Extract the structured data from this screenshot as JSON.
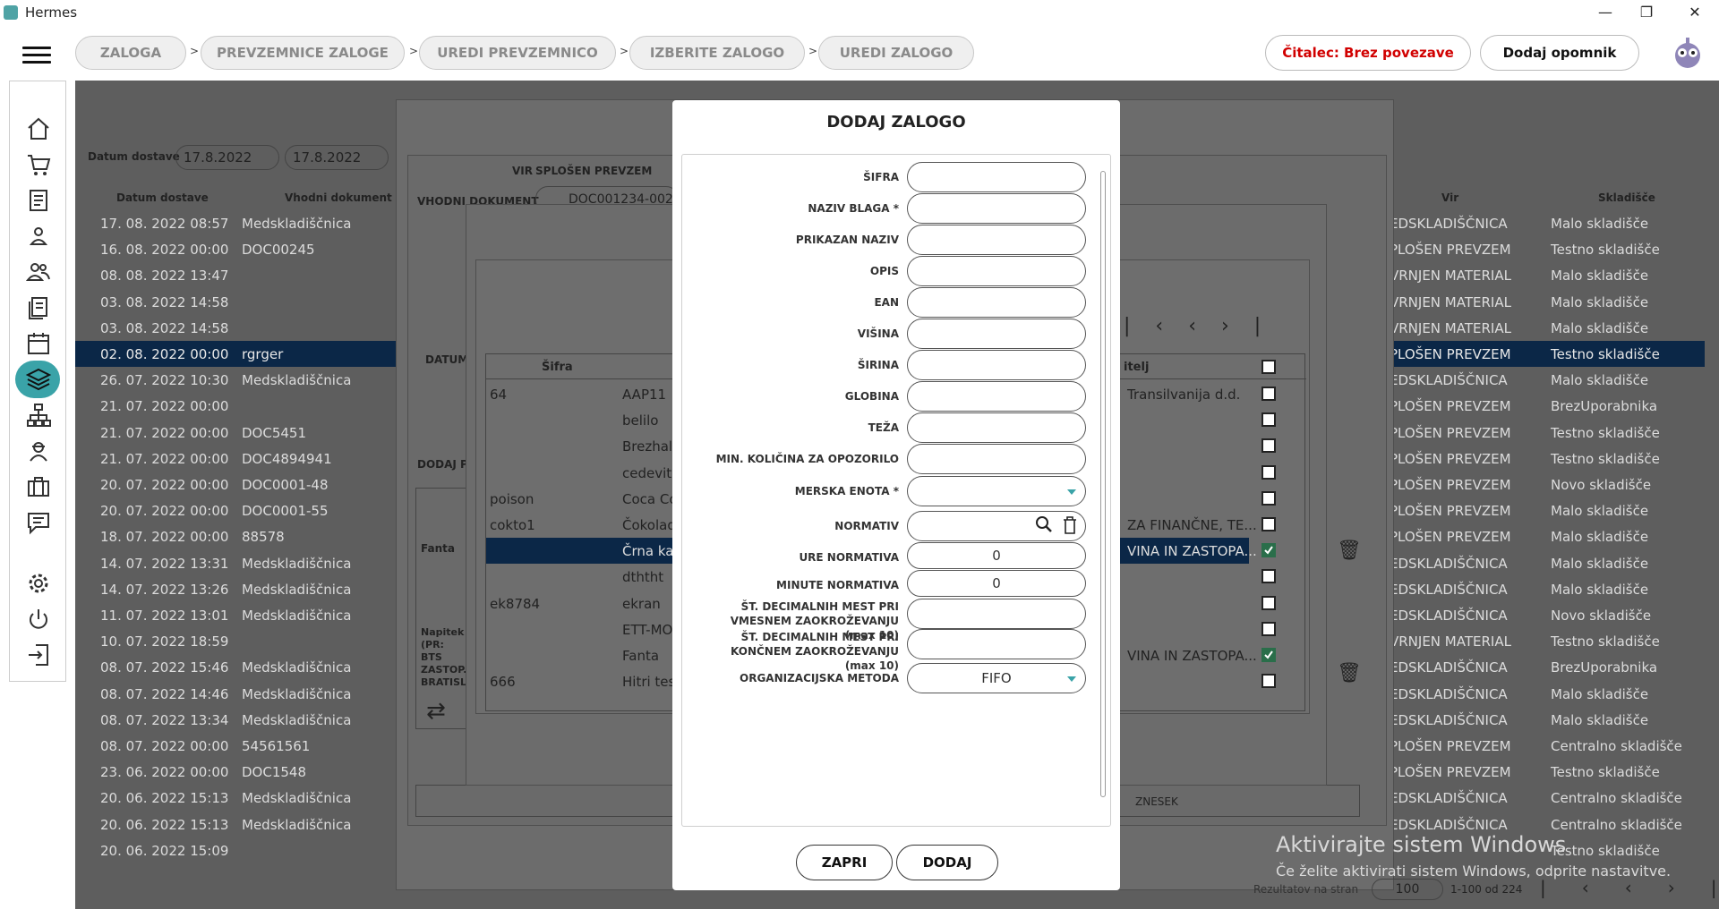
{
  "app": {
    "title": "Hermes",
    "win": {
      "min": "—",
      "max": "❐",
      "close": "✕"
    }
  },
  "breadcrumb": [
    "ZALOGA",
    "PREVZEMNICE ZALOGE",
    "UREDI PREVZEMNICO",
    "IZBERITE ZALOGO",
    "UREDI ZALOGO"
  ],
  "breadcrumb_sep": ">",
  "header": {
    "reader": "Čitalec: Brez povezave",
    "reminder": "Dodaj opomnik"
  },
  "filter": {
    "label": "Datum dostave",
    "from": "17.8.2022",
    "to": "17.8.2022"
  },
  "table": {
    "headers": {
      "date": "Datum dostave",
      "doc": "Vhodni dokument",
      "vir": "Vir",
      "sklad": "Skladišče"
    },
    "rows": [
      [
        "17. 08. 2022 08:57",
        "Medskladiščnica",
        "EDSKLADIŠČNICA",
        "Malo skladišče"
      ],
      [
        "16. 08. 2022 00:00",
        "DOC00245",
        "PLOŠEN PREVZEM",
        "Testno skladišče"
      ],
      [
        "08. 08. 2022 13:47",
        "",
        "VRNJEN MATERIAL",
        "Malo skladišče"
      ],
      [
        "03. 08. 2022 14:58",
        "",
        "VRNJEN MATERIAL",
        "Malo skladišče"
      ],
      [
        "03. 08. 2022 14:58",
        "",
        "VRNJEN MATERIAL",
        "Malo skladišče"
      ],
      [
        "02. 08. 2022 00:00",
        "rgrger",
        "PLOŠEN PREVZEM",
        "Testno skladišče"
      ],
      [
        "26. 07. 2022 10:30",
        "Medskladiščnica",
        "EDSKLADIŠČNICA",
        "Malo skladišče"
      ],
      [
        "21. 07. 2022 00:00",
        "",
        "PLOŠEN PREVZEM",
        "BrezUporabnika"
      ],
      [
        "21. 07. 2022 00:00",
        "DOC5451",
        "PLOŠEN PREVZEM",
        "Testno skladišče"
      ],
      [
        "21. 07. 2022 00:00",
        "DOC4894941",
        "PLOŠEN PREVZEM",
        "Testno skladišče"
      ],
      [
        "20. 07. 2022 00:00",
        "DOC0001-48",
        "PLOŠEN PREVZEM",
        "Novo skladišče"
      ],
      [
        "20. 07. 2022 00:00",
        "DOC0001-55",
        "PLOŠEN PREVZEM",
        "Malo skladišče"
      ],
      [
        "18. 07. 2022 00:00",
        "88578",
        "PLOŠEN PREVZEM",
        "Malo skladišče"
      ],
      [
        "14. 07. 2022 13:31",
        "Medskladiščnica",
        "EDSKLADIŠČNICA",
        "Malo skladišče"
      ],
      [
        "14. 07. 2022 13:26",
        "Medskladiščnica",
        "EDSKLADIŠČNICA",
        "Malo skladišče"
      ],
      [
        "11. 07. 2022 13:01",
        "Medskladiščnica",
        "EDSKLADIŠČNICA",
        "Novo skladišče"
      ],
      [
        "10. 07. 2022 18:59",
        "",
        "VRNJEN MATERIAL",
        "Testno skladišče"
      ],
      [
        "08. 07. 2022 15:46",
        "Medskladiščnica",
        "EDSKLADIŠČNICA",
        "BrezUporabnika"
      ],
      [
        "08. 07. 2022 14:46",
        "Medskladiščnica",
        "EDSKLADIŠČNICA",
        "Malo skladišče"
      ],
      [
        "08. 07. 2022 13:34",
        "Medskladiščnica",
        "EDSKLADIŠČNICA",
        "Malo skladišče"
      ],
      [
        "08. 07. 2022 00:00",
        "54561561",
        "PLOŠEN PREVZEM",
        "Centralno skladišče"
      ],
      [
        "23. 06. 2022 00:00",
        "DOC1548",
        "PLOŠEN PREVZEM",
        "Testno skladišče"
      ],
      [
        "20. 06. 2022 15:13",
        "Medskladiščnica",
        "EDSKLADIŠČNICA",
        "Centralno skladišče"
      ],
      [
        "20. 06. 2022 15:13",
        "Medskladiščnica",
        "EDSKLADIŠČNICA",
        "Centralno skladišče"
      ],
      [
        "20. 06. 2022 15:09",
        "",
        "",
        "Testno skladišče"
      ]
    ]
  },
  "panel1": {
    "vir_label": "VIR",
    "vir_value": "SPLOŠEN PREVZEM",
    "doc_label": "VHODNI DOKUMENT",
    "doc_value": "DOC001234-002",
    "datum_label": "DATUM",
    "dodaj_label": "DODAJ P",
    "fanta": "Fanta",
    "napitek": "Napitek (PR: BTS ZASTOP. BRATISL",
    "znesek": "ZNESEK"
  },
  "inner_table": {
    "col1": "Šifra",
    "col_last": "itelj",
    "rows": [
      [
        "64",
        "AAP11",
        "Transilvanija d.d.",
        false
      ],
      [
        "",
        "belilo",
        "",
        false
      ],
      [
        "",
        "Brezhal",
        "",
        false
      ],
      [
        "",
        "cedevit",
        "",
        false
      ],
      [
        "poison",
        "Coca Co",
        "",
        false
      ],
      [
        "cokto1",
        "Čokolad",
        "ZA FINANČNE, TE...",
        false
      ],
      [
        "",
        "Črna ka",
        "VINA IN ZASTOPA...",
        true
      ],
      [
        "",
        "dththt",
        "",
        false
      ],
      [
        "ek8784",
        "ekran",
        "",
        false
      ],
      [
        "",
        "ETT-MO",
        "",
        false
      ],
      [
        "",
        "Fanta",
        "VINA IN ZASTOPA...",
        true
      ],
      [
        "666",
        "Hitri tes",
        "",
        false
      ]
    ]
  },
  "bottom": {
    "per_page": "Rezultatov na stran",
    "page_value": "100",
    "range": "1-100 od 224"
  },
  "modal": {
    "title": "DODAJ ZALOGO",
    "fields": [
      {
        "label": "ŠIFRA",
        "value": ""
      },
      {
        "label": "NAZIV BLAGA *",
        "value": ""
      },
      {
        "label": "PRIKAZAN NAZIV",
        "value": ""
      },
      {
        "label": "OPIS",
        "value": ""
      },
      {
        "label": "EAN",
        "value": ""
      },
      {
        "label": "VIŠINA",
        "value": ""
      },
      {
        "label": "ŠIRINA",
        "value": ""
      },
      {
        "label": "GLOBINA",
        "value": ""
      },
      {
        "label": "TEŽA",
        "value": ""
      },
      {
        "label": "MIN. KOLIČINA ZA OPOZORILO",
        "value": ""
      },
      {
        "label": "MERSKA ENOTA *",
        "value": ""
      },
      {
        "label": "NORMATIV",
        "value": ""
      },
      {
        "label": "URE NORMATIVA",
        "value": "0"
      },
      {
        "label": "MINUTE NORMATIVA",
        "value": "0"
      },
      {
        "label": "ŠT. DECIMALNIH MEST PRI VMESNEM ZAOKROŽEVANJU (max 10)",
        "value": ""
      },
      {
        "label": "ŠT. DECIMALNIH MEST PRI KONČNEM ZAOKROŽEVANJU (max 10)",
        "value": ""
      },
      {
        "label": "ORGANIZACIJSKA METODA",
        "value": "FIFO"
      }
    ],
    "close": "ZAPRI",
    "add": "DODAJ"
  },
  "watermark": {
    "title": "Aktivirajte sistem Windows",
    "sub": "Če želite aktivirati sistem Windows, odprite nastavitve."
  },
  "colors": {
    "accent": "#3aa3a8",
    "selected_row": "#0b2747",
    "reader_text": "#d10000",
    "overlay": "#5e5e5e"
  }
}
